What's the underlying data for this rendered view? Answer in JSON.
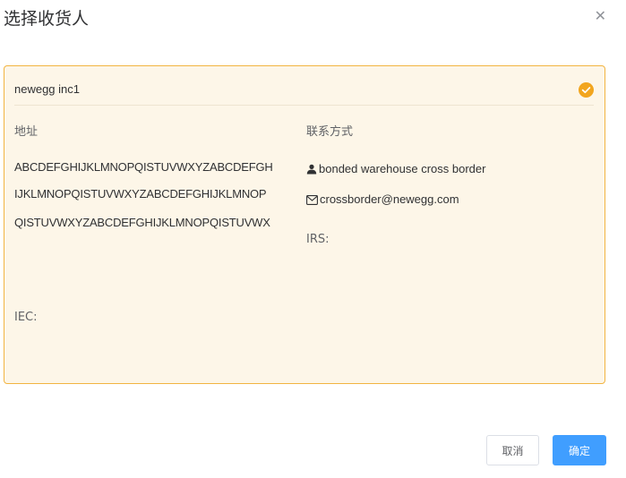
{
  "dialog": {
    "title": "选择收货人",
    "close_icon": "close-icon"
  },
  "card": {
    "name": "newegg inc1",
    "selected": true,
    "colors": {
      "border": "#f2b441",
      "background": "#fdf6e8",
      "check": "#f2a51e"
    },
    "address_label": "地址",
    "contact_label": "联系方式",
    "address_lines": [
      "ABCDEFGHIJKLMNOPQISTUVWXYZABCDEFGH",
      "IJKLMNOPQISTUVWXYZABCDEFGHIJKLMNOP",
      "QISTUVWXYZABCDEFGHIJKLMNOPQISTUVWX"
    ],
    "contact_name": "bonded warehouse cross border",
    "contact_email": "crossborder@newegg.com",
    "irs_label": "IRS:",
    "iec_label": "IEC:"
  },
  "footer": {
    "cancel_label": "取消",
    "confirm_label": "确定",
    "confirm_color": "#409eff"
  }
}
